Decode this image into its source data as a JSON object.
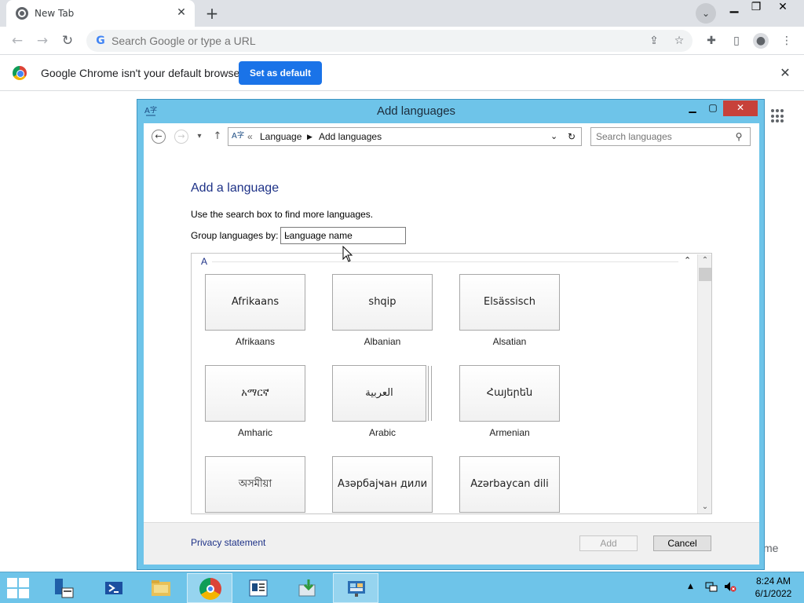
{
  "browser": {
    "tab_title": "New Tab",
    "omnibox_placeholder": "Search Google or type a URL",
    "infobar_message": "Google Chrome isn't your default browser",
    "infobar_button": "Set as default",
    "partial_text": "me"
  },
  "dialog": {
    "title": "Add languages",
    "breadcrumb": [
      "Language",
      "Add languages"
    ],
    "breadcrumb_prefix": "«",
    "search_placeholder": "Search languages",
    "heading": "Add a language",
    "instruction": "Use the search box to find more languages.",
    "group_label": "Group languages by:",
    "group_value": "Language name",
    "group_letter": "A",
    "languages": [
      {
        "native": "Afrikaans",
        "name": "Afrikaans"
      },
      {
        "native": "shqip",
        "name": "Albanian"
      },
      {
        "native": "Elsässisch",
        "name": "Alsatian"
      },
      {
        "native": "አማርኛ",
        "name": "Amharic"
      },
      {
        "native": "العربية",
        "name": "Arabic"
      },
      {
        "native": "Հայերեն",
        "name": "Armenian"
      },
      {
        "native": "অসমীয়া",
        "name": ""
      },
      {
        "native": "Азәрбајҹан дили",
        "name": ""
      },
      {
        "native": "Azərbaycan dili",
        "name": ""
      }
    ],
    "privacy_link": "Privacy statement",
    "add_button": "Add",
    "cancel_button": "Cancel"
  },
  "taskbar": {
    "time": "8:24 AM",
    "date": "6/1/2022"
  }
}
